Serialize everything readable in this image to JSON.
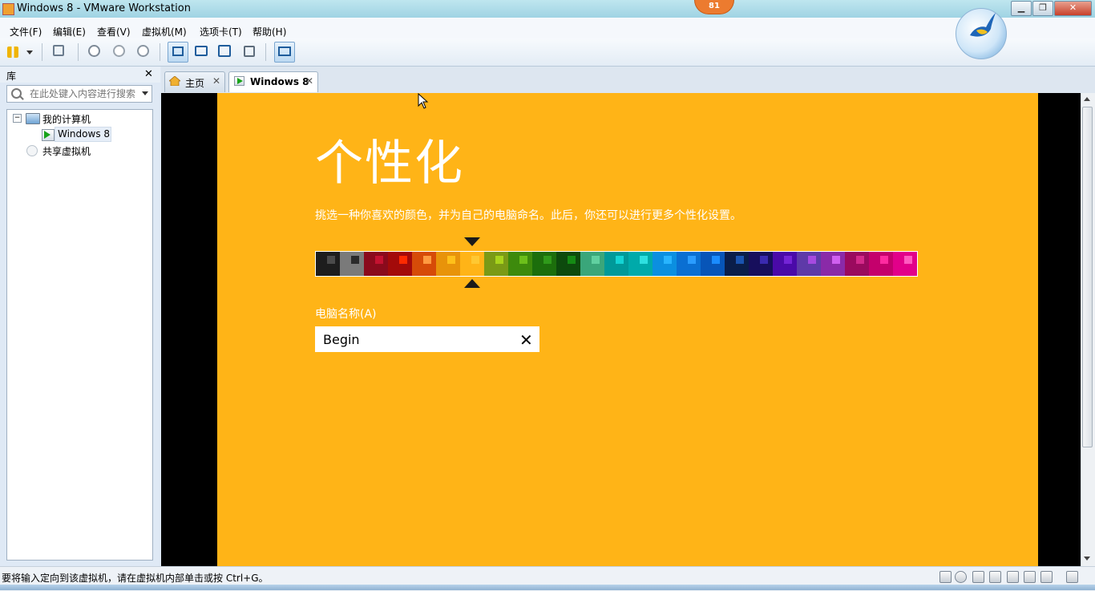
{
  "window": {
    "title": "Windows 8 - VMware Workstation",
    "badge": "81",
    "min": "▁",
    "max": "❐",
    "close": "✕"
  },
  "menu": [
    "文件(F)",
    "编辑(E)",
    "查看(V)",
    "虚拟机(M)",
    "选项卡(T)",
    "帮助(H)"
  ],
  "toolbar": {
    "icons": [
      "pause-icon",
      "dropdown-icon",
      "network-icon",
      "snapshot-icon",
      "revert-icon",
      "snapshot-manager-icon",
      "library-view-icon",
      "console-view-icon",
      "fullscreen-icon",
      "unity-icon",
      "thumbnail-icon"
    ]
  },
  "library": {
    "title": "库",
    "close": "✕",
    "search_placeholder": "在此处键入内容进行搜索",
    "tree": {
      "root": "我的计算机",
      "vm": "Windows 8",
      "shared": "共享虚拟机"
    }
  },
  "tabs": [
    {
      "label": "主页",
      "close": "✕"
    },
    {
      "label": "Windows 8",
      "close": "✕"
    }
  ],
  "vm": {
    "heading": "个性化",
    "description": "挑选一种你喜欢的颜色，并为自己的电脑命名。此后，你还可以进行更多个性化设置。",
    "pc_name_label": "电脑名称(A)",
    "pc_name_value": "Begin",
    "clear": "✕",
    "selected_swatch_index": 6,
    "swatches": [
      {
        "bg": "#1d1d1d",
        "accent": "#4a4a4a"
      },
      {
        "bg": "#7a7a7a",
        "accent": "#2a2a2a"
      },
      {
        "bg": "#8a0a1c",
        "accent": "#c41230"
      },
      {
        "bg": "#a30a0a",
        "accent": "#ff2a00"
      },
      {
        "bg": "#d64b08",
        "accent": "#ff9a40"
      },
      {
        "bg": "#e8930a",
        "accent": "#ffc01a"
      },
      {
        "bg": "#ffb417",
        "accent": "#ffc832"
      },
      {
        "bg": "#7a9a16",
        "accent": "#a8d41c"
      },
      {
        "bg": "#3d8a0c",
        "accent": "#6cbf1a"
      },
      {
        "bg": "#1c6e0c",
        "accent": "#2f9a1a"
      },
      {
        "bg": "#0d4a0d",
        "accent": "#158a14"
      },
      {
        "bg": "#3aa67a",
        "accent": "#60d0a0"
      },
      {
        "bg": "#009999",
        "accent": "#14d4d4"
      },
      {
        "bg": "#00aaaa",
        "accent": "#2ee0e0"
      },
      {
        "bg": "#0b8fe0",
        "accent": "#28b4ff"
      },
      {
        "bg": "#0a6fd2",
        "accent": "#2a9cff"
      },
      {
        "bg": "#0755b8",
        "accent": "#1a8cff"
      },
      {
        "bg": "#0a1e4a",
        "accent": "#1a54b0"
      },
      {
        "bg": "#170f5c",
        "accent": "#3a2ab0"
      },
      {
        "bg": "#4a0aa8",
        "accent": "#7424d6"
      },
      {
        "bg": "#5e3aa8",
        "accent": "#a64ae0"
      },
      {
        "bg": "#8a2aa8",
        "accent": "#d060f0"
      },
      {
        "bg": "#9a0a5e",
        "accent": "#d42a8a"
      },
      {
        "bg": "#c4006c",
        "accent": "#ff2aa0"
      },
      {
        "bg": "#e2008a",
        "accent": "#ff5ac0"
      }
    ]
  },
  "status": {
    "text": "要将输入定向到该虚拟机，请在虚拟机内部单击或按 Ctrl+G。"
  }
}
